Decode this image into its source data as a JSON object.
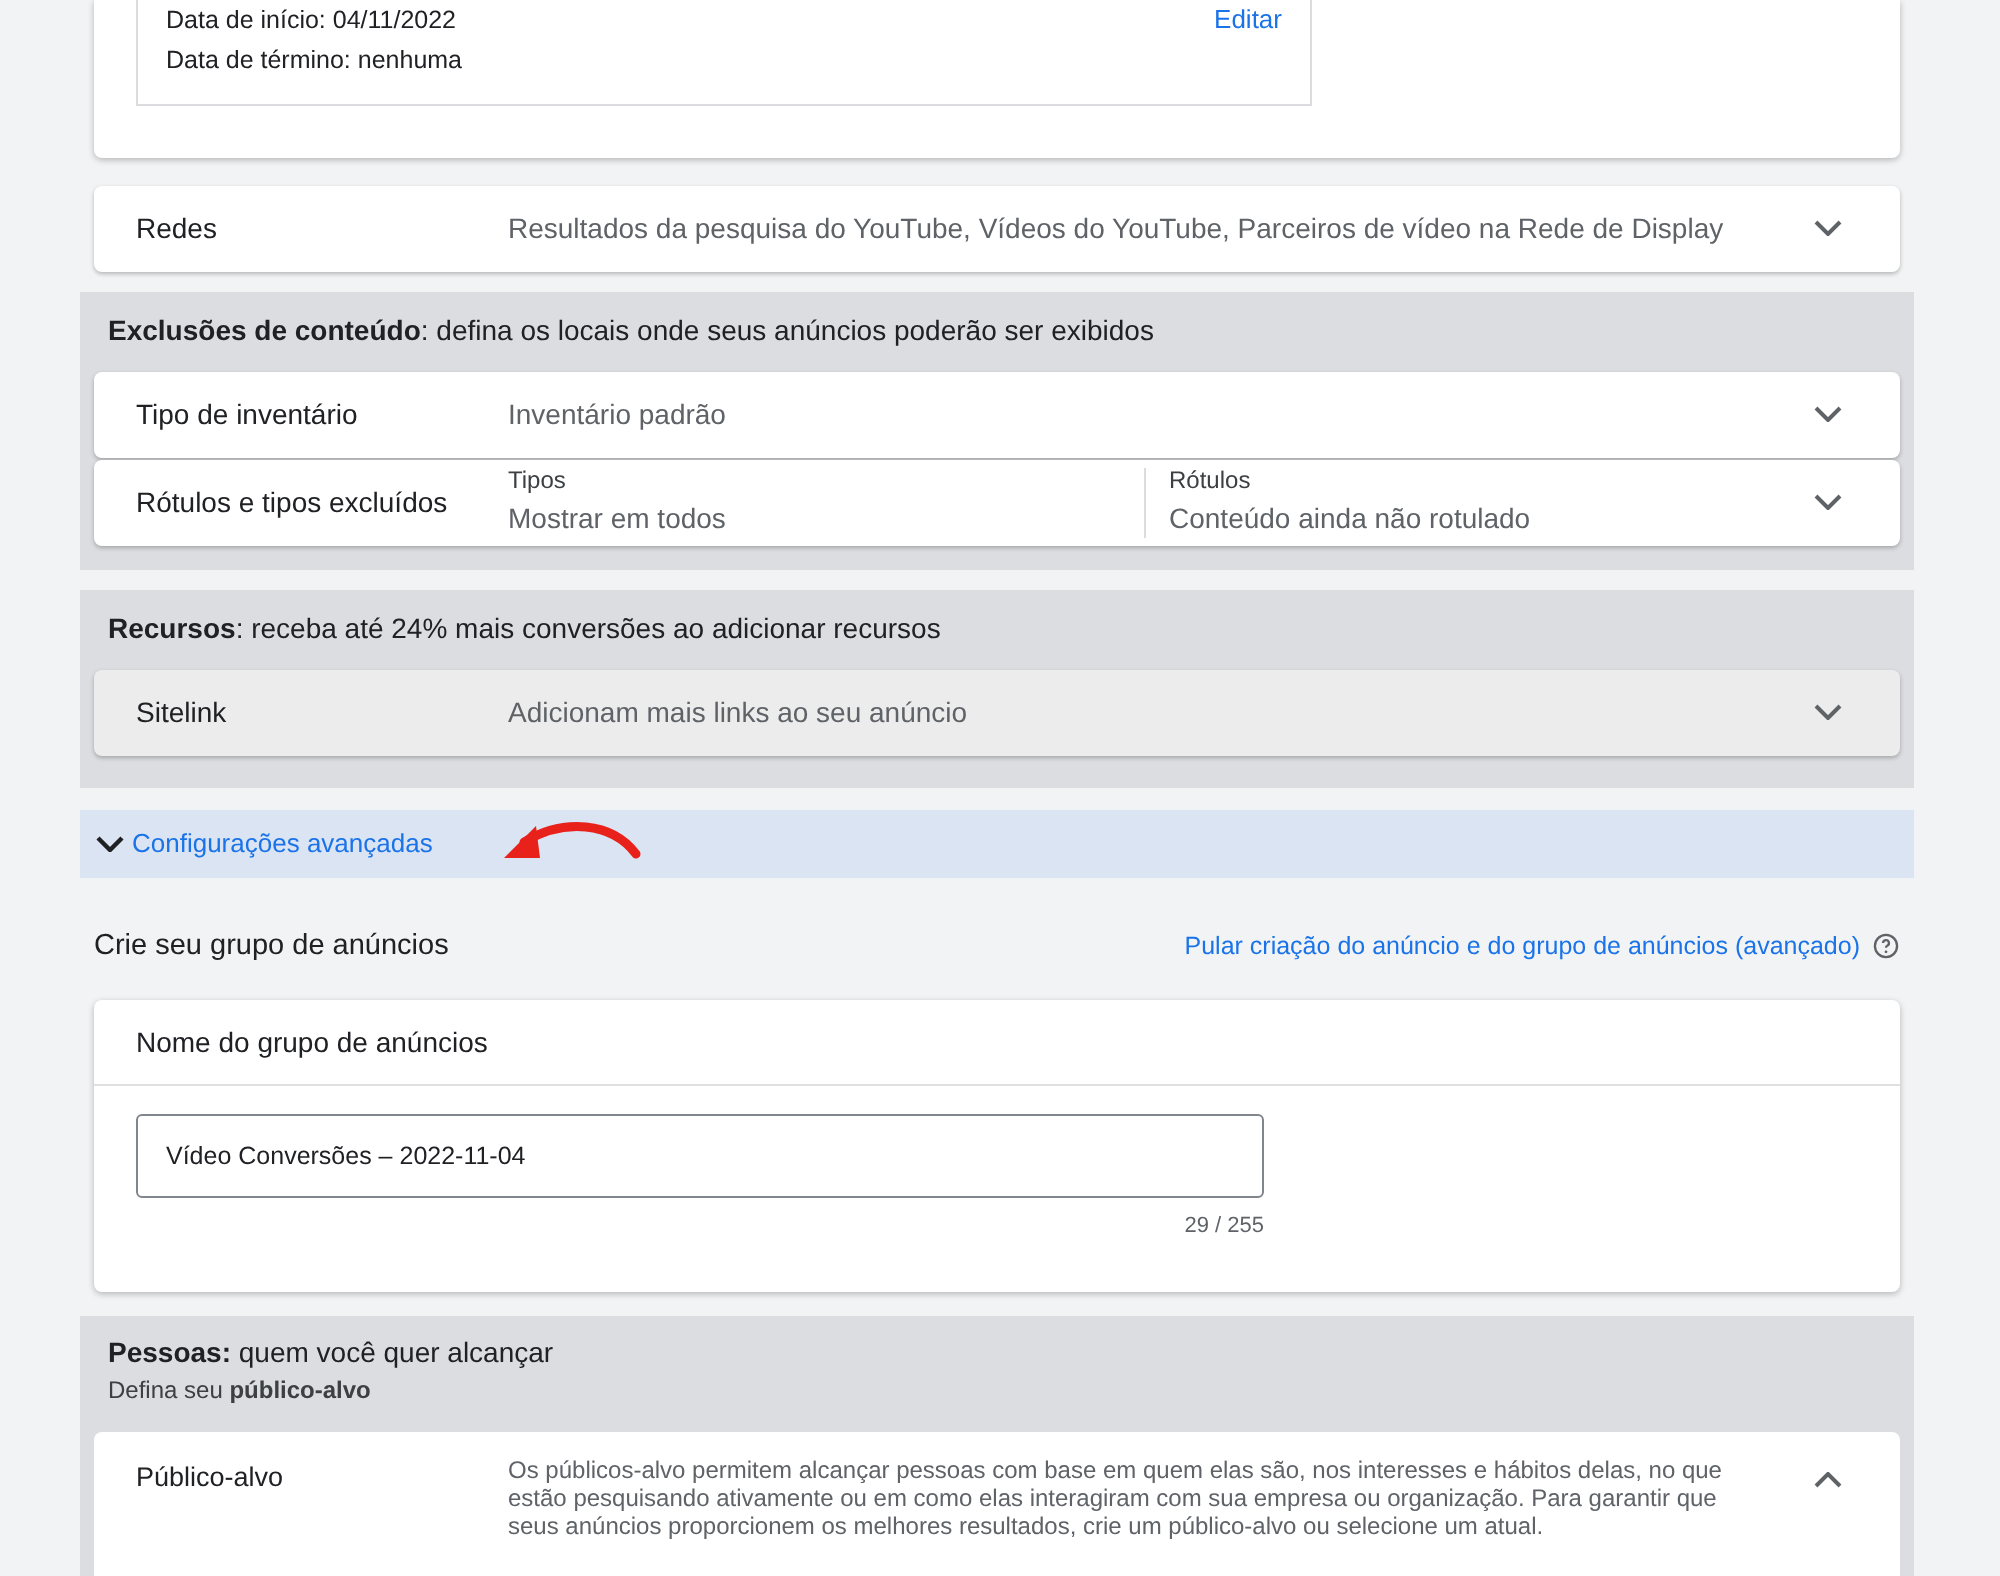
{
  "schedule_card": {
    "lines": [
      "Data de início: 04/11/2022",
      "Data de término: nenhuma"
    ],
    "edit_link": "Editar"
  },
  "networks": {
    "label": "Redes",
    "value": "Resultados da pesquisa do YouTube, Vídeos do YouTube, Parceiros de vídeo na Rede de Display",
    "expanded": false
  },
  "sections": [
    {
      "heading": "**Exclusões de conteúdo**: defina os locais onde seus anúncios poderão ser exibidos",
      "rows": [
        {
          "kind": "simple",
          "label": "Tipo de inventário",
          "value": "Inventário padrão",
          "expanded": false,
          "disabled": false
        },
        {
          "kind": "split",
          "label": "Rótulos e tipos excluídos",
          "fields": [
            {
              "label": "Tipos",
              "value": "Mostrar em todos"
            },
            {
              "label": "Rótulos",
              "value": "Conteúdo ainda não rotulado"
            }
          ],
          "expanded": false,
          "disabled": false
        }
      ]
    },
    {
      "heading": "**Recursos**: receba até 24% mais conversões ao adicionar recursos",
      "rows": [
        {
          "kind": "simple",
          "label": "Sitelink",
          "value": "Adicionam mais links ao seu anúncio",
          "expanded": false,
          "disabled": true
        }
      ]
    }
  ],
  "advanced": {
    "label": "Configurações avançadas",
    "expanded": false
  },
  "ad_group": {
    "title": "Crie seu grupo de anúncios",
    "skip_link": "Pular criação do anúncio e do grupo de anúncios (avançado)",
    "name_card": {
      "title": "Nome do grupo de anúncios",
      "value": "Vídeo Conversões – 2022-11-04",
      "counter": "29 / 255"
    }
  },
  "people": {
    "heading": "**Pessoas:** quem você quer alcançar",
    "subheading": "Defina seu **público-alvo**",
    "row": {
      "label": "Público-alvo",
      "description": "Os públicos-alvo permitem alcançar pessoas com base em quem elas são, nos interesses e hábitos delas, no que estão pesquisando ativamente ou em como elas interagiram com sua empresa ou organização. Para garantir que seus anúncios proporcionem os melhores resultados, crie um público-alvo ou selecione um atual.",
      "expanded": true
    }
  }
}
